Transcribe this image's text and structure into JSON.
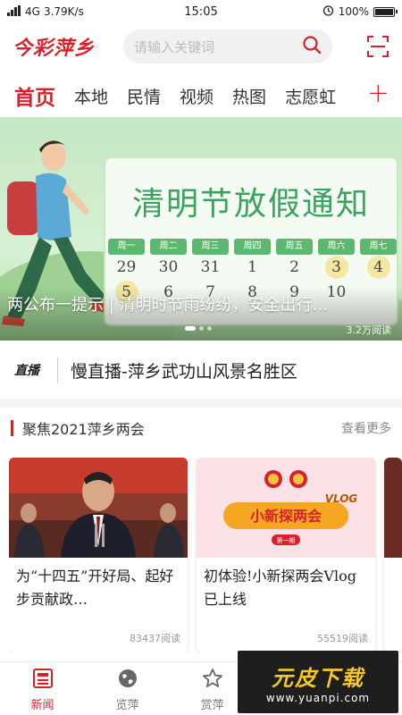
{
  "status_bar": {
    "carrier": "4G",
    "speed": "3.79K/s",
    "time": "15:05",
    "battery": "100%",
    "battery_level": 1.0
  },
  "header": {
    "logo_text": "今彩萍乡",
    "search_placeholder": "请输入关键词"
  },
  "tabs": [
    {
      "label": "首页",
      "active": true
    },
    {
      "label": "本地",
      "active": false
    },
    {
      "label": "民情",
      "active": false
    },
    {
      "label": "视频",
      "active": false
    },
    {
      "label": "热图",
      "active": false
    },
    {
      "label": "志愿虹",
      "active": false
    }
  ],
  "tab_add": "+",
  "banner": {
    "headline": "清明节放假通知",
    "weekdays": [
      "周一",
      "周二",
      "周三",
      "周四",
      "周五",
      "周六",
      "周七"
    ],
    "row1": [
      "29",
      "30",
      "31",
      "1",
      "2",
      "3",
      "4"
    ],
    "row2": [
      "5",
      "6",
      "7",
      "8",
      "9",
      "10",
      ""
    ],
    "caption": "两公布一提示 | 清明时节雨纷纷，安全出行…",
    "reads": "3.2万阅读",
    "slide_count": 3,
    "active_slide": 1
  },
  "live": {
    "tag": "直播",
    "title": "慢直播-萍乡武功山风景名胜区"
  },
  "section": {
    "title": "聚焦2021萍乡两会",
    "more": "查看更多"
  },
  "cards": [
    {
      "title": "为“十四五”开好局、起好步贡献政…",
      "reads": "83437阅读"
    },
    {
      "title": "初体验!小新探两会Vlog已上线",
      "reads": "55519阅读",
      "image_text": "小新探两会",
      "image_badge": "VLOG",
      "image_sub": "第一期"
    }
  ],
  "bottom_nav": [
    {
      "label": "新闻",
      "icon": "newspaper-icon",
      "active": true
    },
    {
      "label": "览萍",
      "icon": "globe-icon",
      "active": false
    },
    {
      "label": "赏萍",
      "icon": "star-icon",
      "active": false
    }
  ],
  "watermark": {
    "main": "元皮下载",
    "url": "www.yuanpi.com"
  },
  "colors": {
    "brand_red": "#d8212c",
    "calendar_green": "#3aa360"
  }
}
